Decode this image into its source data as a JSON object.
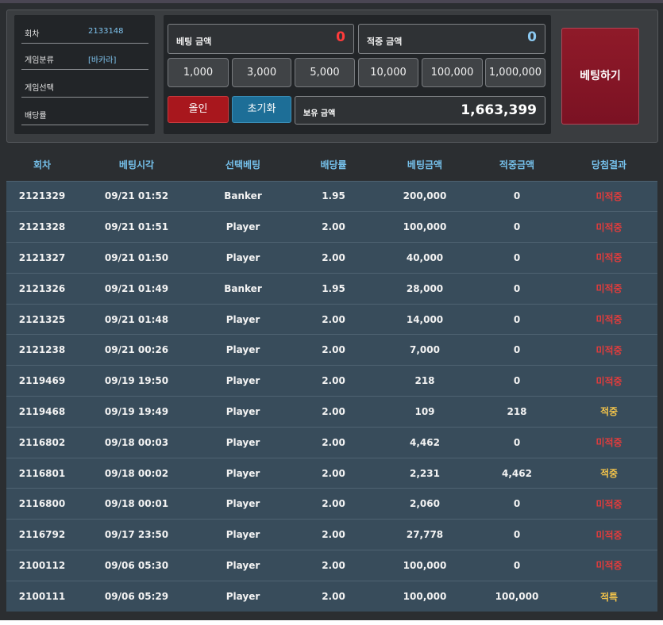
{
  "info": {
    "rows": [
      {
        "label": "회차",
        "value": "2133148"
      },
      {
        "label": "게임분류",
        "value": "[바카라]"
      },
      {
        "label": "게임선택",
        "value": ""
      },
      {
        "label": "배당률",
        "value": ""
      }
    ]
  },
  "bet": {
    "bet_amount_label": "베팅 금액",
    "bet_amount_value": "0",
    "win_amount_label": "적중 금액",
    "win_amount_value": "0",
    "chips": [
      "1,000",
      "3,000",
      "5,000",
      "10,000",
      "100,000",
      "1,000,000"
    ],
    "allin_label": "올인",
    "reset_label": "초기화",
    "hold_label": "보유 금액",
    "hold_value": "1,663,399",
    "submit_label": "베팅하기"
  },
  "colors": {
    "bet_amount": "#ff3b3b",
    "win_amount": "#8ccaf2",
    "lose": "#e13c3c",
    "win": "#f4c44a"
  },
  "table": {
    "headers": [
      "회차",
      "베팅시각",
      "선택베팅",
      "배당률",
      "베팅금액",
      "적중금액",
      "당첨결과"
    ],
    "rows": [
      [
        "2121329",
        "09/21 01:52",
        "Banker",
        "1.95",
        "200,000",
        "0",
        "미적중"
      ],
      [
        "2121328",
        "09/21 01:51",
        "Player",
        "2.00",
        "100,000",
        "0",
        "미적중"
      ],
      [
        "2121327",
        "09/21 01:50",
        "Player",
        "2.00",
        "40,000",
        "0",
        "미적중"
      ],
      [
        "2121326",
        "09/21 01:49",
        "Banker",
        "1.95",
        "28,000",
        "0",
        "미적중"
      ],
      [
        "2121325",
        "09/21 01:48",
        "Player",
        "2.00",
        "14,000",
        "0",
        "미적중"
      ],
      [
        "2121238",
        "09/21 00:26",
        "Player",
        "2.00",
        "7,000",
        "0",
        "미적중"
      ],
      [
        "2119469",
        "09/19 19:50",
        "Player",
        "2.00",
        "218",
        "0",
        "미적중"
      ],
      [
        "2119468",
        "09/19 19:49",
        "Player",
        "2.00",
        "109",
        "218",
        "적중"
      ],
      [
        "2116802",
        "09/18 00:03",
        "Player",
        "2.00",
        "4,462",
        "0",
        "미적중"
      ],
      [
        "2116801",
        "09/18 00:02",
        "Player",
        "2.00",
        "2,231",
        "4,462",
        "적중"
      ],
      [
        "2116800",
        "09/18 00:01",
        "Player",
        "2.00",
        "2,060",
        "0",
        "미적중"
      ],
      [
        "2116792",
        "09/17 23:50",
        "Player",
        "2.00",
        "27,778",
        "0",
        "미적중"
      ],
      [
        "2100112",
        "09/06 05:30",
        "Player",
        "2.00",
        "100,000",
        "0",
        "미적중"
      ],
      [
        "2100111",
        "09/06 05:29",
        "Player",
        "2.00",
        "100,000",
        "100,000",
        "적특"
      ]
    ]
  }
}
